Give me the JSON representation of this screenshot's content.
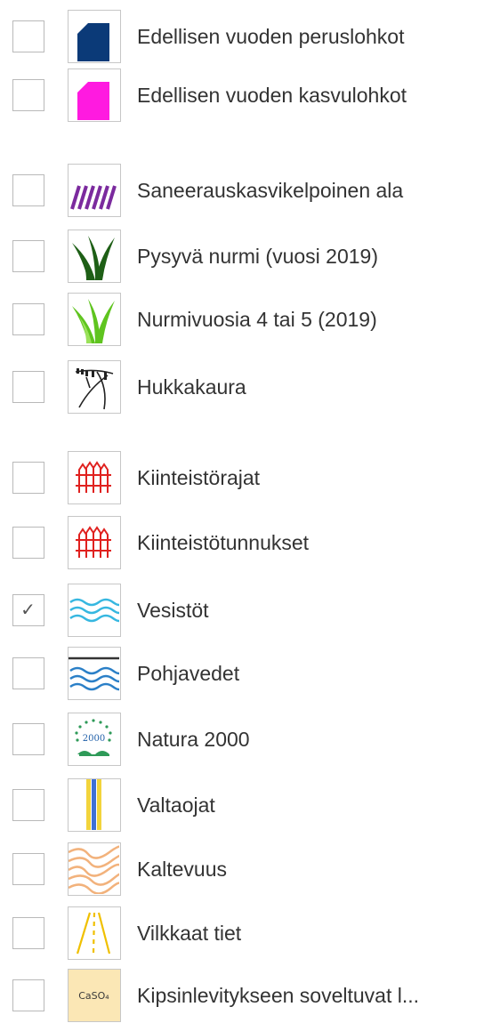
{
  "layers": [
    {
      "label": "Edellisen vuoden peruslohkot",
      "checked": false,
      "icon": "parcel-navy-icon",
      "color": "#0b3a78"
    },
    {
      "label": "Edellisen vuoden kasvulohkot",
      "checked": false,
      "icon": "parcel-magenta-icon",
      "color": "#ff1ae0"
    },
    {
      "label": "Saneerauskasvikelpoinen ala",
      "checked": false,
      "icon": "hatched-area-icon",
      "color": "#7b2a9e"
    },
    {
      "label": "Pysyvä nurmi (vuosi 2019)",
      "checked": false,
      "icon": "dark-grass-icon",
      "color": "#1e5f16"
    },
    {
      "label": "Nurmivuosia 4 tai 5 (2019)",
      "checked": false,
      "icon": "light-grass-icon",
      "color": "#5fc41f"
    },
    {
      "label": "Hukkakaura",
      "checked": false,
      "icon": "wild-oat-icon",
      "color": "#222222"
    },
    {
      "label": "Kiinteistörajat",
      "checked": false,
      "icon": "property-fence-icon",
      "color": "#e0211f"
    },
    {
      "label": "Kiinteistötunnukset",
      "checked": false,
      "icon": "property-fence-icon",
      "color": "#e0211f"
    },
    {
      "label": "Vesistöt",
      "checked": true,
      "check_glyph": "✓",
      "icon": "water-waves-icon",
      "color": "#36b7e0"
    },
    {
      "label": "Pohjavedet",
      "checked": false,
      "icon": "groundwater-waves-icon",
      "color": "#2a7fc7"
    },
    {
      "label": "Natura 2000",
      "checked": false,
      "icon": "natura-2000-icon",
      "icon_text": "2000",
      "color": "#2e9a58"
    },
    {
      "label": "Valtaojat",
      "checked": false,
      "icon": "main-ditch-icon",
      "color": "#f2d43c"
    },
    {
      "label": "Kaltevuus",
      "checked": false,
      "icon": "slope-contours-icon",
      "color": "#f2b27c"
    },
    {
      "label": "Vilkkaat tiet",
      "checked": false,
      "icon": "busy-road-icon",
      "color": "#f0c000"
    },
    {
      "label": "Kipsinlevitykseen soveltuvat l...",
      "checked": false,
      "icon": "gypsum-caso4-icon",
      "icon_text": "CaSO₄",
      "color": "#fbe7b5"
    }
  ]
}
